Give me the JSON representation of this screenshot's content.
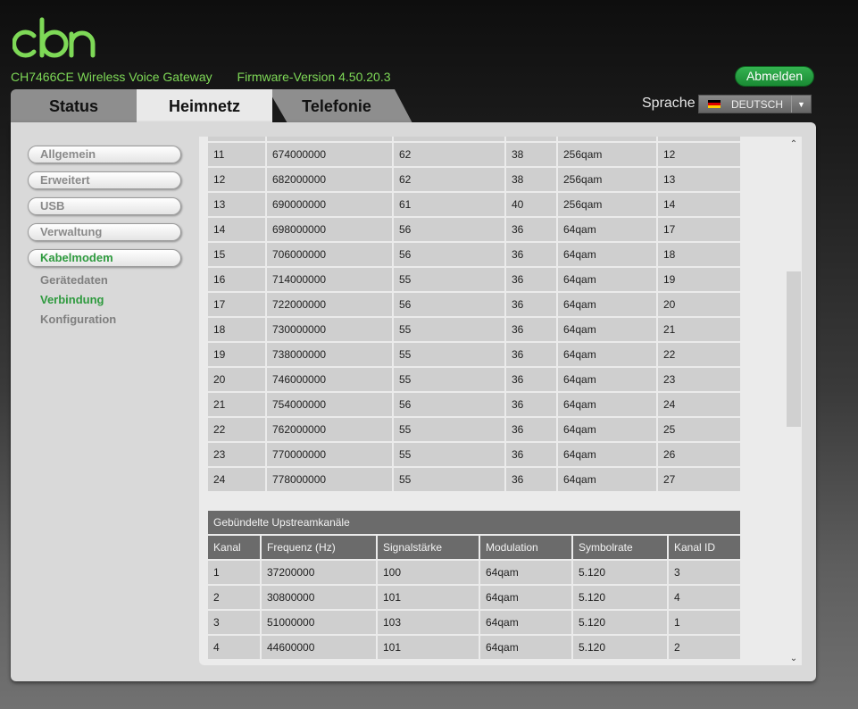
{
  "header": {
    "logo_text": "cbn",
    "model": "CH7466CE  Wireless Voice Gateway",
    "firmware": "Firmware-Version  4.50.20.3",
    "logout_label": "Abmelden"
  },
  "tabs": [
    {
      "label": "Status"
    },
    {
      "label": "Heimnetz"
    },
    {
      "label": "Telefonie"
    }
  ],
  "language": {
    "label": "Sprache",
    "selected": "DEUTSCH"
  },
  "sidebar": {
    "items": [
      {
        "label": "Allgemein"
      },
      {
        "label": "Erweitert"
      },
      {
        "label": "USB"
      },
      {
        "label": "Verwaltung"
      },
      {
        "label": "Kabelmodem"
      }
    ],
    "subitems": [
      {
        "label": "Gerätedaten"
      },
      {
        "label": "Verbindung"
      },
      {
        "label": "Konfiguration"
      }
    ]
  },
  "downstream": {
    "rows": [
      [
        "11",
        "674000000",
        "62",
        "38",
        "256qam",
        "12"
      ],
      [
        "12",
        "682000000",
        "62",
        "38",
        "256qam",
        "13"
      ],
      [
        "13",
        "690000000",
        "61",
        "40",
        "256qam",
        "14"
      ],
      [
        "14",
        "698000000",
        "56",
        "36",
        "64qam",
        "17"
      ],
      [
        "15",
        "706000000",
        "56",
        "36",
        "64qam",
        "18"
      ],
      [
        "16",
        "714000000",
        "55",
        "36",
        "64qam",
        "19"
      ],
      [
        "17",
        "722000000",
        "56",
        "36",
        "64qam",
        "20"
      ],
      [
        "18",
        "730000000",
        "55",
        "36",
        "64qam",
        "21"
      ],
      [
        "19",
        "738000000",
        "55",
        "36",
        "64qam",
        "22"
      ],
      [
        "20",
        "746000000",
        "55",
        "36",
        "64qam",
        "23"
      ],
      [
        "21",
        "754000000",
        "56",
        "36",
        "64qam",
        "24"
      ],
      [
        "22",
        "762000000",
        "55",
        "36",
        "64qam",
        "25"
      ],
      [
        "23",
        "770000000",
        "55",
        "36",
        "64qam",
        "26"
      ],
      [
        "24",
        "778000000",
        "55",
        "36",
        "64qam",
        "27"
      ]
    ]
  },
  "upstream": {
    "title": "Gebündelte Upstreamkanäle",
    "headers": [
      "Kanal",
      "Frequenz (Hz)",
      "Signalstärke",
      "Modulation",
      "Symbolrate",
      "Kanal ID"
    ],
    "rows": [
      [
        "1",
        "37200000",
        "100",
        "64qam",
        "5.120",
        "3"
      ],
      [
        "2",
        "30800000",
        "101",
        "64qam",
        "5.120",
        "4"
      ],
      [
        "3",
        "51000000",
        "103",
        "64qam",
        "5.120",
        "1"
      ],
      [
        "4",
        "44600000",
        "101",
        "64qam",
        "5.120",
        "2"
      ]
    ]
  },
  "colors": {
    "brand_green": "#7ed957",
    "accent_green": "#2e9a3e",
    "header_gray": "#6b6b6b"
  }
}
